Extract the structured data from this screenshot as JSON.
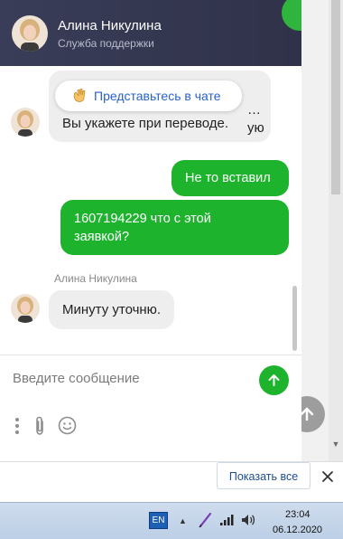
{
  "header": {
    "agent_name": "Алина Никулина",
    "agent_role": "Служба поддержки"
  },
  "messages": {
    "intro_pill": "Представьтесь в чате",
    "agent_partial": "Вы укажете при переводе.",
    "agent_partial_hidden": "…ую",
    "user_1": "Не то вставил",
    "user_2": "1607194229 что с этой\nзаявкой?",
    "sender_label": "Алина Никулина",
    "agent_reply": "Минуту уточню."
  },
  "composer": {
    "placeholder": "Введите сообщение"
  },
  "notification": {
    "show_all": "Показать все"
  },
  "taskbar": {
    "language": "EN",
    "time": "23:04",
    "date": "06.12.2020"
  },
  "colors": {
    "accent_green": "#1db32d",
    "header_bg": "#2f3249",
    "link_blue": "#2a62c9"
  }
}
